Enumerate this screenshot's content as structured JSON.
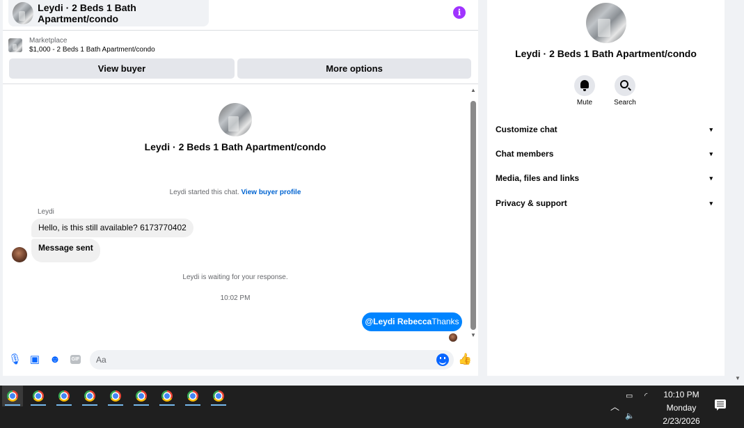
{
  "header": {
    "title": "Leydi · 2 Beds 1 Bath Apartment/condo",
    "info_icon": "i"
  },
  "listing": {
    "label": "Marketplace",
    "detail": "$1,000 - 2 Beds 1 Bath Apartment/condo"
  },
  "actions": {
    "view_buyer": "View buyer",
    "more_options": "More options"
  },
  "conversation": {
    "title": "Leydi · 2 Beds 1 Bath Apartment/condo",
    "started_text": "Leydi started this chat.",
    "started_link": "View buyer profile",
    "sender_name": "Leydi",
    "messages_in": [
      "Hello, is this still available? 6173770402",
      "Message sent"
    ],
    "waiting": "Leydi is waiting for your response.",
    "timestamp": "10:02 PM",
    "message_out_mention": "@Leydi Rebecca",
    "message_out_text": "Thanks"
  },
  "composer": {
    "placeholder": "Aa",
    "gif_label": "GIF"
  },
  "info_panel": {
    "title": "Leydi · 2 Beds 1 Bath Apartment/condo",
    "mute_label": "Mute",
    "search_label": "Search",
    "sections": [
      "Customize chat",
      "Chat members",
      "Media, files and links",
      "Privacy & support"
    ]
  },
  "taskbar": {
    "time": "10:10 PM",
    "day": "Monday",
    "date": "2/23/2026",
    "app_count": 9
  },
  "colors": {
    "accent": "#0084ff",
    "info": "#a033ff"
  }
}
